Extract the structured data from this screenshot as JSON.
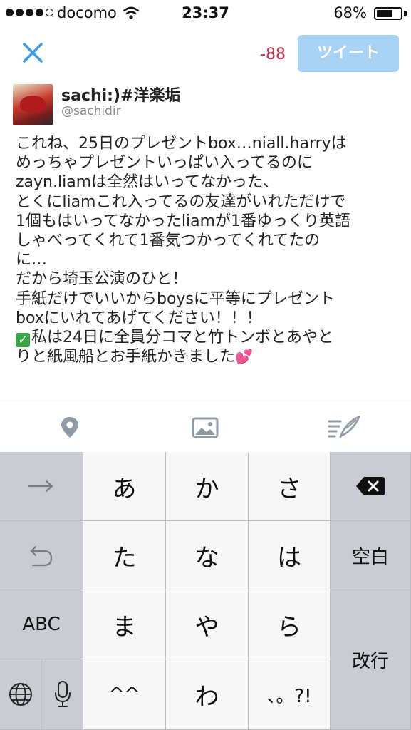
{
  "status_bar": {
    "carrier": "docomo",
    "time": "23:37",
    "battery": "68%",
    "battery_level": 0.68,
    "signal_bars": 4,
    "signal_max": 5
  },
  "nav": {
    "close_icon": "close-icon",
    "char_count": "-88",
    "tweet_label": "ツイート",
    "tweet_color": "#a9d3f5",
    "count_color": "#d1324a"
  },
  "compose": {
    "author_name": "sachi:)#洋楽垢",
    "author_handle": "@sachidir",
    "lines": [
      "これね、25日のプレゼントbox…niall.harryは",
      "めっちゃプレゼントいっぱい入ってるのに",
      "zayn.liamは全然はいってなかった、",
      "とくにliamこれ入ってるの友達がいれただけで",
      "1個もはいってなかったliamが1番ゆっくり英語",
      "しゃべってくれて1番気つかってくれてたの",
      "に…",
      "だから埼玉公演のひと！",
      "手紙だけでいいからboysに平等にプレゼント",
      "boxにいれてあげてください！！！"
    ],
    "last_line_1": "私は24日に全員分コマと竹トンボとあやと",
    "last_line_2": "りと紙風船とお手紙かきました"
  },
  "toolbar": {
    "icons": [
      "location-pin-icon",
      "photo-icon",
      "compose-draft-icon"
    ]
  },
  "keyboard": {
    "row1": [
      "→",
      "あ",
      "か",
      "さ"
    ],
    "row2": [
      "た",
      "な",
      "は"
    ],
    "space": "空白",
    "row3": [
      "ABC",
      "ま",
      "や",
      "ら"
    ],
    "return": "改行",
    "row4": [
      "^^",
      "わ",
      "、。?!"
    ]
  }
}
